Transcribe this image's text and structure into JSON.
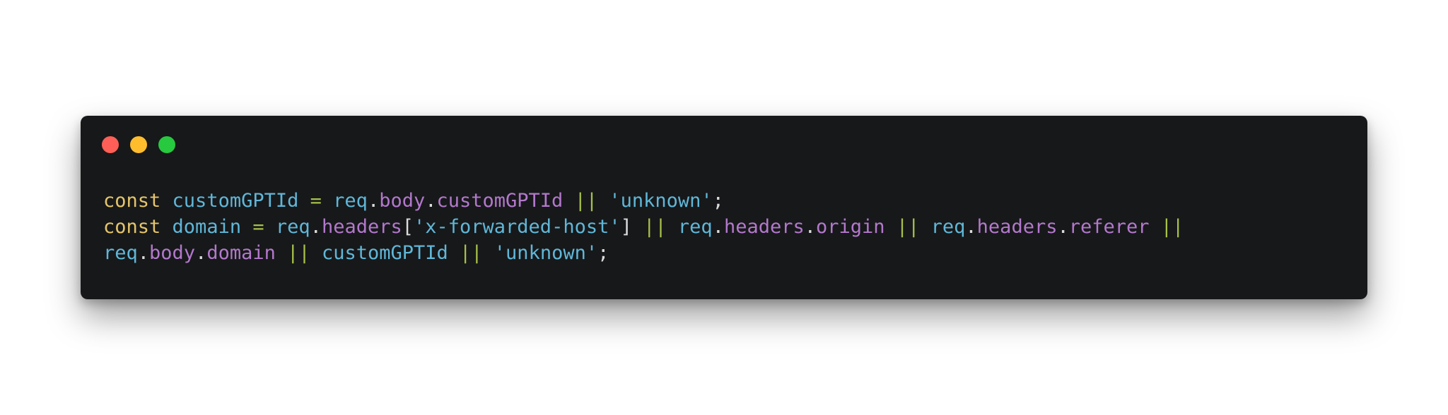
{
  "window": {
    "buttons": [
      {
        "name": "close",
        "color": "#ff5f56"
      },
      {
        "name": "minimize",
        "color": "#ffbd2e"
      },
      {
        "name": "maximize",
        "color": "#27c93f"
      }
    ]
  },
  "palette": {
    "keyword": "#e5c56a",
    "identifier": "#5fb7d8",
    "property": "#b378cc",
    "operator": "#a6c14a",
    "string": "#5fb7d8",
    "punctuation": "#dcdcdc"
  },
  "code": {
    "lines": [
      [
        {
          "t": "const",
          "k": "keyword"
        },
        {
          "t": " ",
          "k": "punctuation"
        },
        {
          "t": "customGPTId",
          "k": "identifier"
        },
        {
          "t": " ",
          "k": "punctuation"
        },
        {
          "t": "=",
          "k": "operator"
        },
        {
          "t": " ",
          "k": "punctuation"
        },
        {
          "t": "req",
          "k": "identifier"
        },
        {
          "t": ".",
          "k": "punctuation"
        },
        {
          "t": "body",
          "k": "property"
        },
        {
          "t": ".",
          "k": "punctuation"
        },
        {
          "t": "customGPTId",
          "k": "property"
        },
        {
          "t": " ",
          "k": "punctuation"
        },
        {
          "t": "||",
          "k": "operator"
        },
        {
          "t": " ",
          "k": "punctuation"
        },
        {
          "t": "'unknown'",
          "k": "string"
        },
        {
          "t": ";",
          "k": "punctuation"
        }
      ],
      [
        {
          "t": "const",
          "k": "keyword"
        },
        {
          "t": " ",
          "k": "punctuation"
        },
        {
          "t": "domain",
          "k": "identifier"
        },
        {
          "t": " ",
          "k": "punctuation"
        },
        {
          "t": "=",
          "k": "operator"
        },
        {
          "t": " ",
          "k": "punctuation"
        },
        {
          "t": "req",
          "k": "identifier"
        },
        {
          "t": ".",
          "k": "punctuation"
        },
        {
          "t": "headers",
          "k": "property"
        },
        {
          "t": "[",
          "k": "punctuation"
        },
        {
          "t": "'x-forwarded-host'",
          "k": "string"
        },
        {
          "t": "]",
          "k": "punctuation"
        },
        {
          "t": " ",
          "k": "punctuation"
        },
        {
          "t": "||",
          "k": "operator"
        },
        {
          "t": " ",
          "k": "punctuation"
        },
        {
          "t": "req",
          "k": "identifier"
        },
        {
          "t": ".",
          "k": "punctuation"
        },
        {
          "t": "headers",
          "k": "property"
        },
        {
          "t": ".",
          "k": "punctuation"
        },
        {
          "t": "origin",
          "k": "property"
        },
        {
          "t": " ",
          "k": "punctuation"
        },
        {
          "t": "||",
          "k": "operator"
        },
        {
          "t": " ",
          "k": "punctuation"
        },
        {
          "t": "req",
          "k": "identifier"
        },
        {
          "t": ".",
          "k": "punctuation"
        },
        {
          "t": "headers",
          "k": "property"
        },
        {
          "t": ".",
          "k": "punctuation"
        },
        {
          "t": "referer",
          "k": "property"
        },
        {
          "t": " ",
          "k": "punctuation"
        },
        {
          "t": "||",
          "k": "operator"
        }
      ],
      [
        {
          "t": "req",
          "k": "identifier"
        },
        {
          "t": ".",
          "k": "punctuation"
        },
        {
          "t": "body",
          "k": "property"
        },
        {
          "t": ".",
          "k": "punctuation"
        },
        {
          "t": "domain",
          "k": "property"
        },
        {
          "t": " ",
          "k": "punctuation"
        },
        {
          "t": "||",
          "k": "operator"
        },
        {
          "t": " ",
          "k": "punctuation"
        },
        {
          "t": "customGPTId",
          "k": "identifier"
        },
        {
          "t": " ",
          "k": "punctuation"
        },
        {
          "t": "||",
          "k": "operator"
        },
        {
          "t": " ",
          "k": "punctuation"
        },
        {
          "t": "'unknown'",
          "k": "string"
        },
        {
          "t": ";",
          "k": "punctuation"
        }
      ]
    ]
  }
}
